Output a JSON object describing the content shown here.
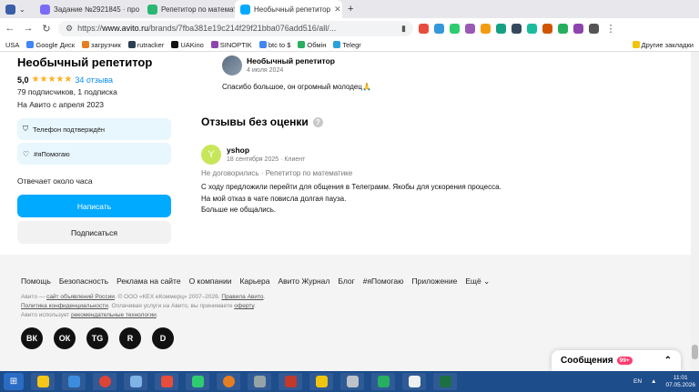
{
  "browser": {
    "tabs": [
      {
        "label": "Задание №2921845 · про",
        "active": false,
        "color": "#7b6cf6"
      },
      {
        "label": "Репетитор по математике",
        "active": false,
        "color": "#2bb673"
      },
      {
        "label": "Необычный репетитор",
        "active": true,
        "color": "#00aaff"
      }
    ],
    "url_prefix": "https://",
    "url_host": "www.avito.ru",
    "url_path": "/brands/7fba381e19c214f29f21bba076add516/all/..."
  },
  "bookmarks": {
    "items": [
      "USA",
      "Google Диск",
      "загрузчик",
      "rutracker",
      "UAKino",
      "SINOPTIK",
      "btc to $",
      "Обмін",
      "Telegr"
    ],
    "other": "Другие закладки"
  },
  "seller": {
    "name": "Необычный репетитор",
    "rating": "5,0",
    "stars": "★★★★★",
    "reviews_link": "34 отзыва",
    "subscribers": "79 подписчиков, 1 подписка",
    "since": "На Авито с апреля 2023",
    "badge_phone": "Телефон подтверждён",
    "badge_help": "#яПомогаю",
    "response": "Отвечает около часа",
    "write_button": "Написать",
    "subscribe_button": "Подписаться"
  },
  "top_review": {
    "author": "Необычный репетитор",
    "date": "4 июля 2024",
    "text": "Спасибо большое, он огромный молодец🙏"
  },
  "section": {
    "title": "Отзывы без оценки",
    "help_icon": "?"
  },
  "review": {
    "avatar_letter": "Y",
    "author": "yshop",
    "meta": "18 сентября 2025 · Клиент",
    "deal": "Не договорились · Репетитор по математике",
    "lines": [
      "С ходу предложили перейти для общения в Телеграмм. Якобы для ускорения процесса.",
      "На мой отказ в чате повисла долгая пауза.",
      "Больше не общались."
    ]
  },
  "footer": {
    "nav": [
      "Помощь",
      "Безопасность",
      "Реклама на сайте",
      "О компании",
      "Карьера",
      "Авито Журнал",
      "Блог",
      "#яПомогаю",
      "Приложение",
      "Ещё"
    ],
    "line1_a": "Авито — ",
    "line1_link1": "сайт объявлений России",
    "line1_b": ". © ООО «КЕХ еКоммерц» 2007–2026. ",
    "line1_link2": "Правила Авито",
    "line1_c": ".",
    "line2_link1": "Политика конфиденциальности",
    "line2_b": ". Оплачивая услуги на Авито, вы принимаете ",
    "line2_link2": "оферту",
    "line2_c": ".",
    "line3_a": "Авито использует ",
    "line3_link": "рекомендательные технологии",
    "line3_b": ".",
    "socials": [
      "ВК",
      "ОК",
      "TG",
      "R",
      "D"
    ]
  },
  "messages": {
    "label": "Сообщения",
    "count": "99+"
  },
  "taskbar": {
    "lang": "EN",
    "time": "11:01",
    "date": "07.05.2026"
  },
  "colors": {
    "accent": "#00aaff",
    "star": "#ffb021",
    "badge_bg": "#e8f6fd"
  }
}
